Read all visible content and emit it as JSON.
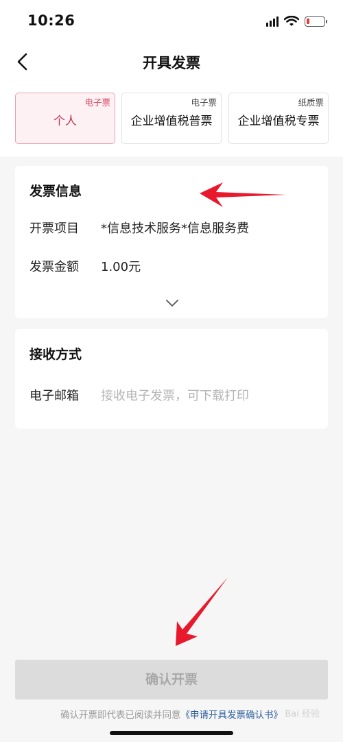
{
  "status_bar": {
    "time": "10:26",
    "icons": [
      "signal-icon",
      "wifi-icon",
      "battery-icon"
    ],
    "battery_color": "#e23b3b"
  },
  "nav": {
    "title": "开具发票",
    "back_icon": "chevron-left-icon"
  },
  "invoice_types": [
    {
      "tag": "电子票",
      "label": "个人",
      "selected": true
    },
    {
      "tag": "电子票",
      "label": "企业增值税普票",
      "selected": false
    },
    {
      "tag": "纸质票",
      "label": "企业增值税专票",
      "selected": false
    }
  ],
  "invoice_info": {
    "title": "发票信息",
    "item_label": "开票项目",
    "item_value": "*信息技术服务*信息服务费",
    "amount_label": "发票金额",
    "amount_value": "1.00元",
    "expand_icon": "chevron-down-icon"
  },
  "receive": {
    "title": "接收方式",
    "email_label": "电子邮箱",
    "email_placeholder": "接收电子发票，可下载打印"
  },
  "confirm_button": {
    "label": "确认开票"
  },
  "agreement": {
    "prefix": "确认开票即代表已阅读并同意",
    "link": "《申请开具发票确认书》"
  },
  "watermark": "Bai 经验",
  "colors": {
    "accent": "#c23a52",
    "annotation_arrow": "#e8192c"
  }
}
